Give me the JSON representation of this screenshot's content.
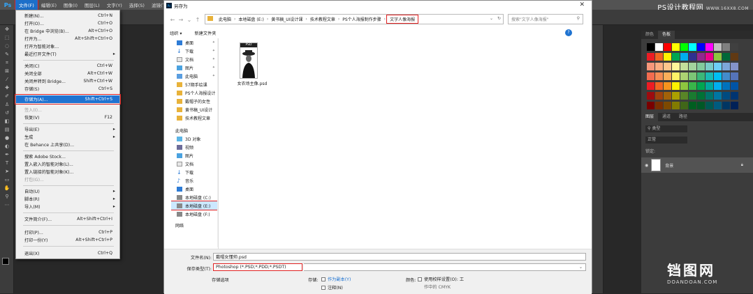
{
  "app": {
    "logo": "Ps",
    "menus": [
      "文件(F)",
      "编辑(E)",
      "图像(I)",
      "图层(L)",
      "文字(Y)",
      "选择(S)",
      "滤镜(T)"
    ],
    "watermark_top": "PS设计教程网",
    "watermark_top_sub": "WWW.16XX8.COM"
  },
  "file_menu": {
    "items": [
      {
        "label": "新建(N)...",
        "shortcut": "Ctrl+N"
      },
      {
        "label": "打开(O)...",
        "shortcut": "Ctrl+O"
      },
      {
        "label": "在 Bridge 中浏览(B)...",
        "shortcut": "Alt+Ctrl+O"
      },
      {
        "label": "打开为...",
        "shortcut": "Alt+Shift+Ctrl+O"
      },
      {
        "label": "打开为智能对象..."
      },
      {
        "label": "最近打开文件(T)"
      },
      {
        "label": "关闭(C)",
        "shortcut": "Ctrl+W"
      },
      {
        "label": "关闭全部",
        "shortcut": "Alt+Ctrl+W"
      },
      {
        "label": "关闭并转到 Bridge...",
        "shortcut": "Shift+Ctrl+W"
      },
      {
        "label": "存储(S)",
        "shortcut": "Ctrl+S"
      },
      {
        "label": "存储为(A)...",
        "shortcut": "Shift+Ctrl+S"
      },
      {
        "label": "签入(I)..."
      },
      {
        "label": "恢复(V)",
        "shortcut": "F12"
      },
      {
        "label": "导出(E)"
      },
      {
        "label": "生成"
      },
      {
        "label": "在 Behance 上共享(D)..."
      },
      {
        "label": "搜索 Adobe Stock..."
      },
      {
        "label": "置入嵌入的智能对象(L)..."
      },
      {
        "label": "置入链接的智能对象(K)..."
      },
      {
        "label": "打包(G)..."
      },
      {
        "label": "自动(U)"
      },
      {
        "label": "脚本(R)"
      },
      {
        "label": "导入(M)"
      },
      {
        "label": "文件简介(F)...",
        "shortcut": "Alt+Shift+Ctrl+I"
      },
      {
        "label": "打印(P)...",
        "shortcut": "Ctrl+P"
      },
      {
        "label": "打印一份(Y)",
        "shortcut": "Alt+Shift+Ctrl+P"
      },
      {
        "label": "退出(X)",
        "shortcut": "Ctrl+Q"
      }
    ]
  },
  "dialog": {
    "title": "另存为",
    "breadcrumbs": [
      "此电脑",
      "本地磁盘 (E:)",
      "黄书稿_UI设计课",
      "技术教程文章",
      "PS个人海报制作步骤",
      "文字人像海报"
    ],
    "search_placeholder": "搜索\"文字人像海报\"",
    "organize": "组织 ▾",
    "new_folder": "新建文件夹",
    "help": "?",
    "nav": {
      "quick_access": [
        "桌面",
        "下载",
        "文档",
        "图片",
        "此电脑",
        "57期手绘课",
        "PS个人海报设计",
        "戴帽子的女性",
        "黄书稿_UI设计",
        "技术教程文章"
      ],
      "this_pc_label": "此电脑",
      "this_pc": [
        "3D 对象",
        "视频",
        "图片",
        "文档",
        "下载",
        "音乐",
        "桌面",
        "本地磁盘 (C:)",
        "本地磁盘 (E:)",
        "本地磁盘 (F:)"
      ],
      "network": "网络"
    },
    "file": {
      "name": "女农场主像.psd",
      "tag": "PSD"
    },
    "filename_label": "文件名(N):",
    "filename_value": "戴帽女懂帅.psd",
    "filetype_label": "保存类型(T):",
    "filetype_value": "Photoshop (*.PSD;*.PDD;*.PSDT)",
    "save_options_label": "存储选项",
    "store_label": "存储:",
    "as_copy": "作为副本(Y)",
    "notes": "注释(N)",
    "color_label": "颜色:",
    "use_proof": "使用校样设置(O): 工",
    "working_cmyk": "作中的 CMYK"
  },
  "panels": {
    "swatch_tabs": [
      "颜色",
      "色板"
    ],
    "layers_tabs": [
      "图层",
      "通道",
      "路径"
    ],
    "kind_label": "类型",
    "blend_mode": "正常",
    "lock_label": "锁定:",
    "layer_name": "背景"
  },
  "watermark_bottom": {
    "big": "铛图网",
    "small": "DOANDOAN.COM"
  },
  "colors": {
    "accent": "#1f73d1",
    "highlight_red": "#e02020",
    "ps_bg": "#282828",
    "ps_panel": "#3c3c3c"
  }
}
